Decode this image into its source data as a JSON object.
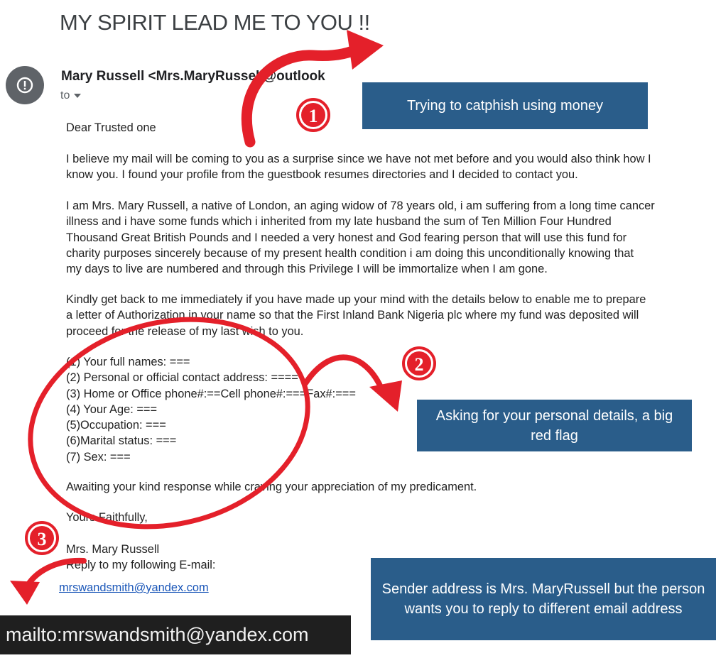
{
  "email": {
    "subject": "MY SPIRIT LEAD ME TO YOU !!",
    "sender": "Mary Russell <Mrs.MaryRussell@outlook",
    "to_label": "to",
    "greeting": "Dear Trusted one",
    "para1": [
      "I believe my mail will be coming to you as a surprise since we have not met before and you would also think how I",
      "know you. I found your profile from the guestbook resumes directories and I decided to contact you."
    ],
    "para2": [
      "I am Mrs. Mary Russell, a native of London, an aging widow of 78 years old, i am suffering from a long time cancer",
      "illness and i have some funds which i inherited from my late husband the sum of Ten Million Four Hundred",
      "Thousand Great British Pounds and I needed a very honest and God fearing person that will use this fund for",
      "charity purposes sincerely because of my present health condition i am doing this unconditionally knowing that",
      "my days to live are numbered and through this Privilege I will be immortalize when I am gone."
    ],
    "para3": [
      "Kindly get back to me immediately if you have made up your mind with the details below to enable me to prepare",
      "a letter of Authorization in your name so that the First Inland Bank Nigeria plc where my fund was deposited will",
      "proceed for the release of my last wish to you."
    ],
    "details": [
      "(1) Your full names: ===",
      "(2) Personal or official contact address: ====",
      "(3) Home or Office phone#:==Cell phone#:===Fax#:===",
      "(4) Your Age: ===",
      "(5)Occupation: ===",
      "(6)Marital status: ===",
      "(7) Sex: ==="
    ],
    "closing": "Awaiting your kind response while craving your appreciation of my predicament.",
    "signoff": "Yours Faithfully,",
    "signature": "Mrs. Mary Russell",
    "reply_line": "Reply to my following E-mail:",
    "reply_link": "mrswandsmith@yandex.com"
  },
  "mailto_hover": "mailto:mrswandsmith@yandex.com",
  "annotations": {
    "marker1": "1",
    "marker2": "2",
    "marker3": "3",
    "callout1": "Trying to catphish using money",
    "callout2": "Asking for your personal details, a big red flag",
    "callout3": "Sender address is Mrs. MaryRussell but the person wants you to reply to different email address"
  },
  "colors": {
    "annotation_red": "#e4202a",
    "callout_blue": "#2a5d8a",
    "link_blue": "#1a56b8"
  },
  "icons": {
    "avatar": "alert-circle-icon",
    "to_dropdown": "caret-down-icon"
  }
}
